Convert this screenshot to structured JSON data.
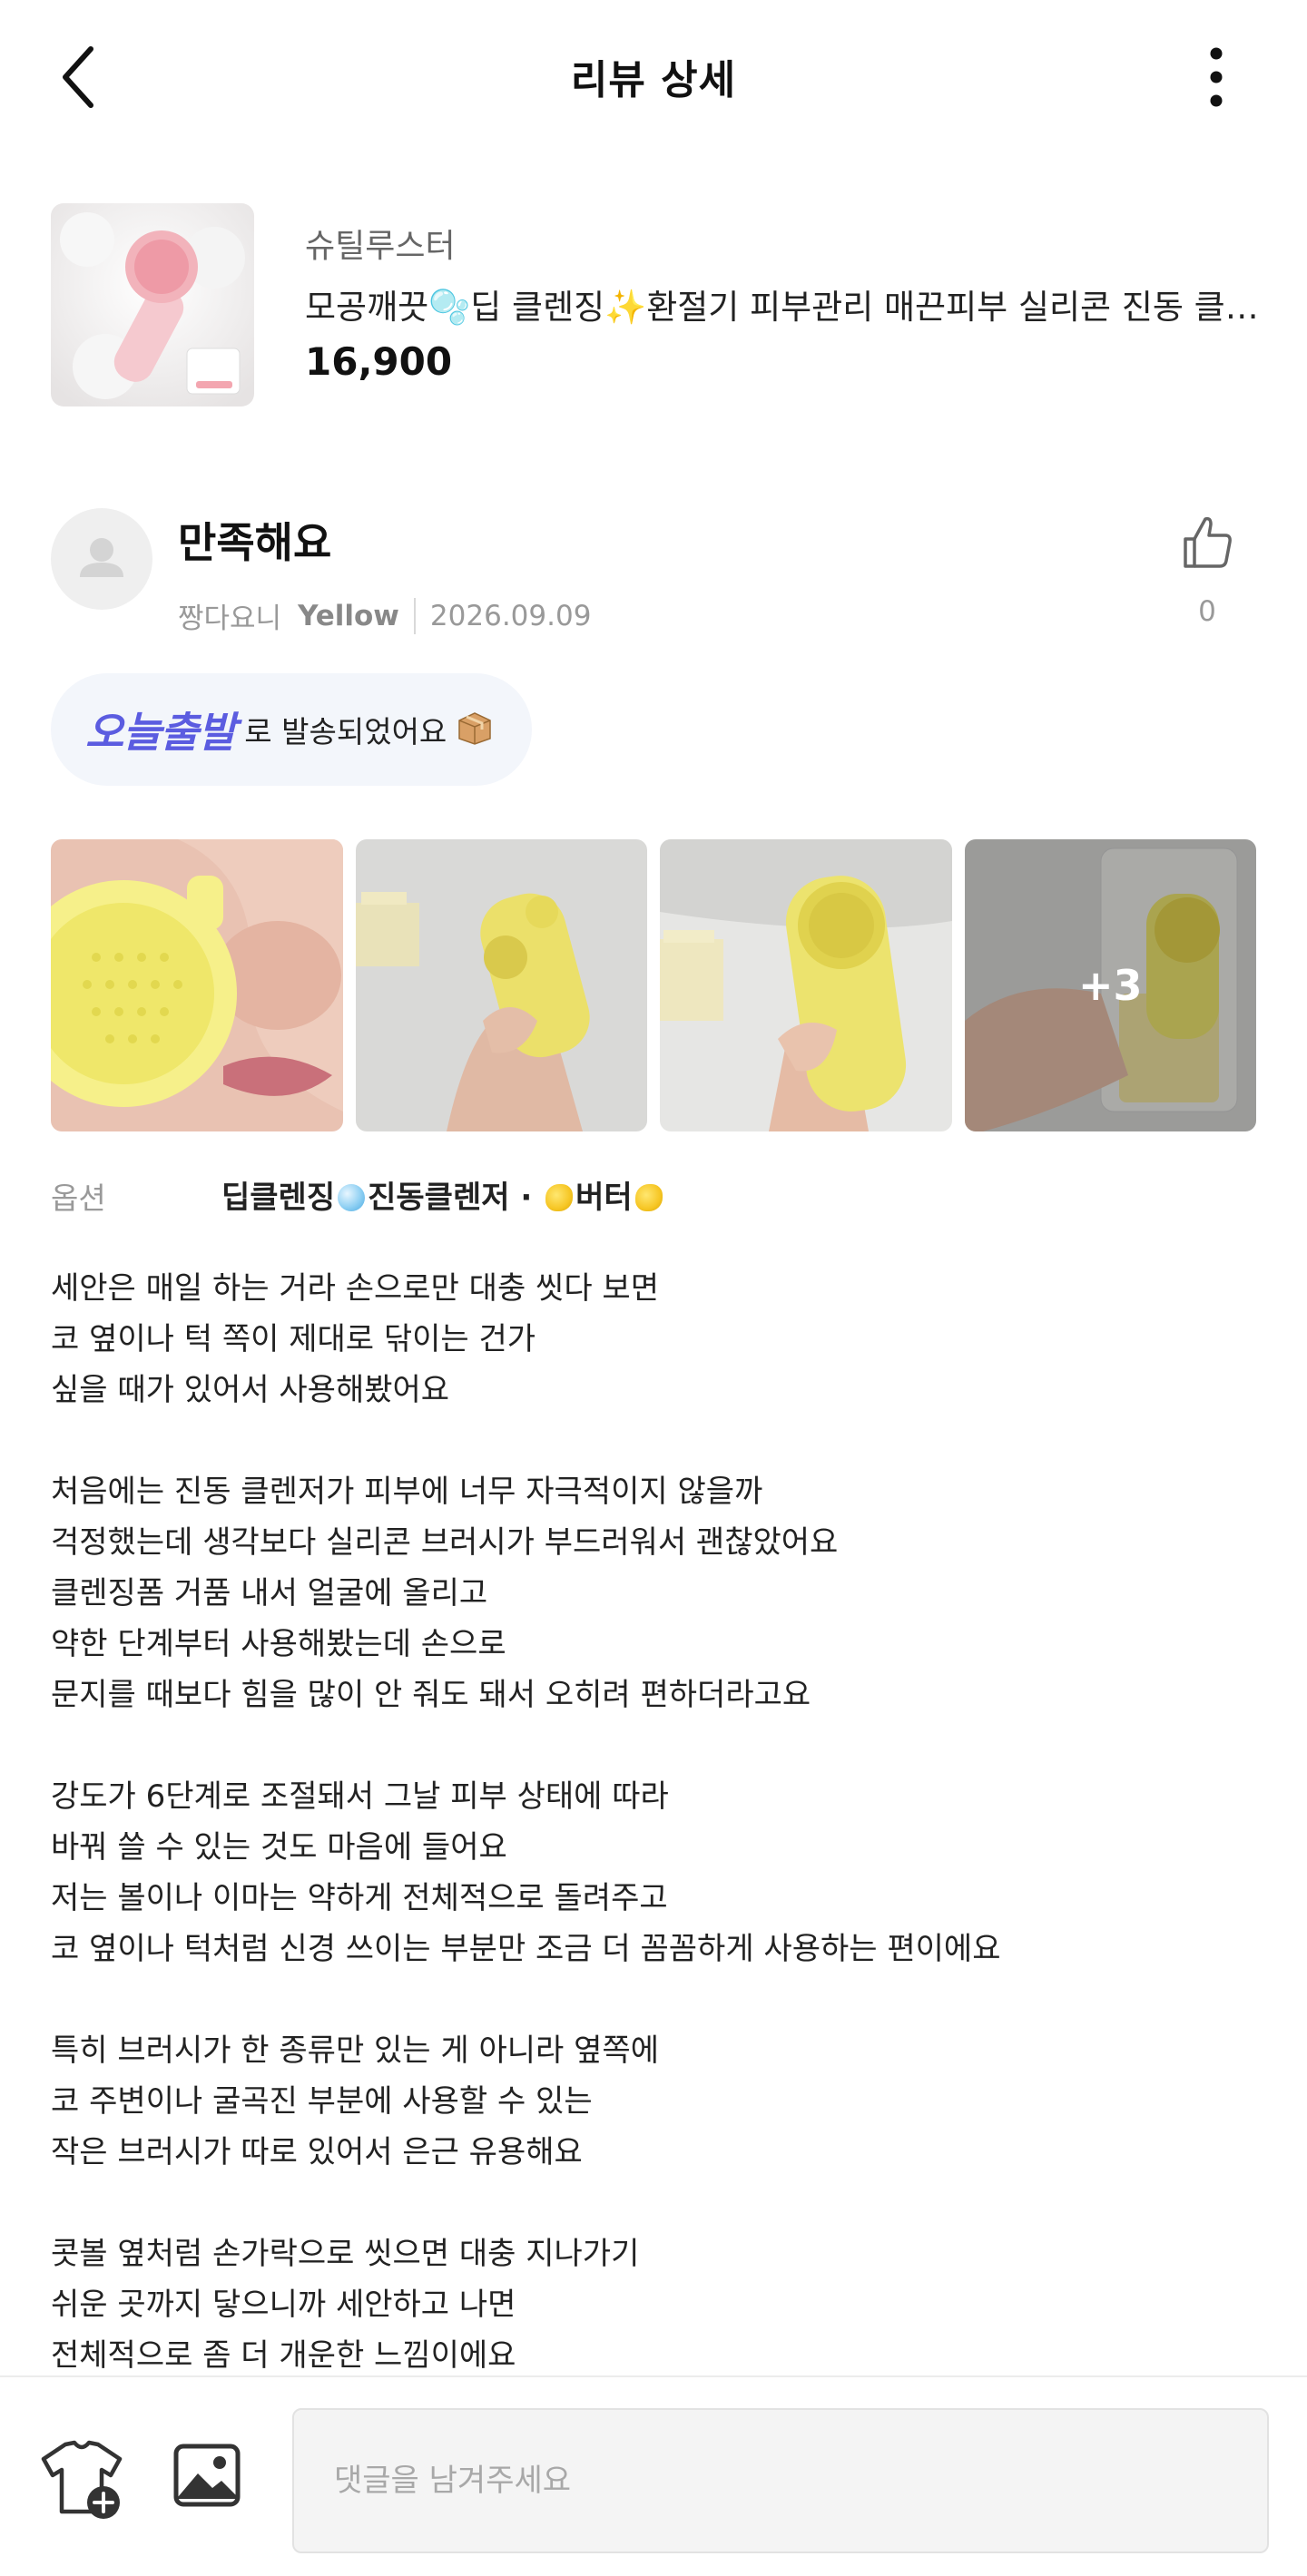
{
  "header": {
    "title": "리뷰 상세",
    "back_icon": "chevron-left-icon",
    "more_icon": "more-vertical-icon"
  },
  "product": {
    "brand": "슈틸루스터",
    "name": "모공깨끗🫧딥 클렌징✨환절기 피부관리 매끈피부 실리콘 진동 클렌저",
    "price": "16,900"
  },
  "review": {
    "title": "만족해요",
    "author": "짱다요니",
    "level": "Yellow",
    "date": "2026.09.09",
    "like_count": "0"
  },
  "shipping": {
    "brand": "오늘출발",
    "text": "로 발송되었어요"
  },
  "photos": {
    "more_label": "+3"
  },
  "option": {
    "label": "옵션",
    "part1": "딥클렌징",
    "part2": "진동클렌저 · ",
    "part3": "버터"
  },
  "body": {
    "paragraphs": [
      "세안은 매일 하는 거라 손으로만 대충 씻다 보면\n코 옆이나 턱 쪽이 제대로 닦이는 건가\n싶을 때가 있어서 사용해봤어요",
      "처음에는 진동 클렌저가 피부에 너무 자극적이지 않을까\n걱정했는데 생각보다 실리콘 브러시가 부드러워서 괜찮았어요\n클렌징폼 거품 내서 얼굴에 올리고\n약한 단계부터 사용해봤는데 손으로\n문지를 때보다 힘을 많이 안 줘도 돼서 오히려 편하더라고요",
      "강도가 6단계로 조절돼서 그날 피부 상태에 따라\n바꿔 쓸 수 있는 것도 마음에 들어요\n저는 볼이나 이마는 약하게 전체적으로 돌려주고\n코 옆이나 턱처럼 신경 쓰이는 부분만 조금 더 꼼꼼하게 사용하는 편이에요",
      "특히 브러시가 한 종류만 있는 게 아니라 옆쪽에\n코 주변이나 굴곡진 부분에 사용할 수 있는\n작은 브러시가 따로 있어서 은근 유용해요",
      "콧볼 옆처럼 손가락으로 씻으면 대충 지나가기\n쉬운 곳까지 닿으니까 세안하고 나면\n전체적으로 좀 더 개운한 느낌이에요"
    ]
  },
  "comment": {
    "placeholder": "댓글을 남겨주세요"
  },
  "colors": {
    "accent": "#5b5ce0",
    "badge_bg": "#f3f6fb",
    "muted": "#999999"
  }
}
